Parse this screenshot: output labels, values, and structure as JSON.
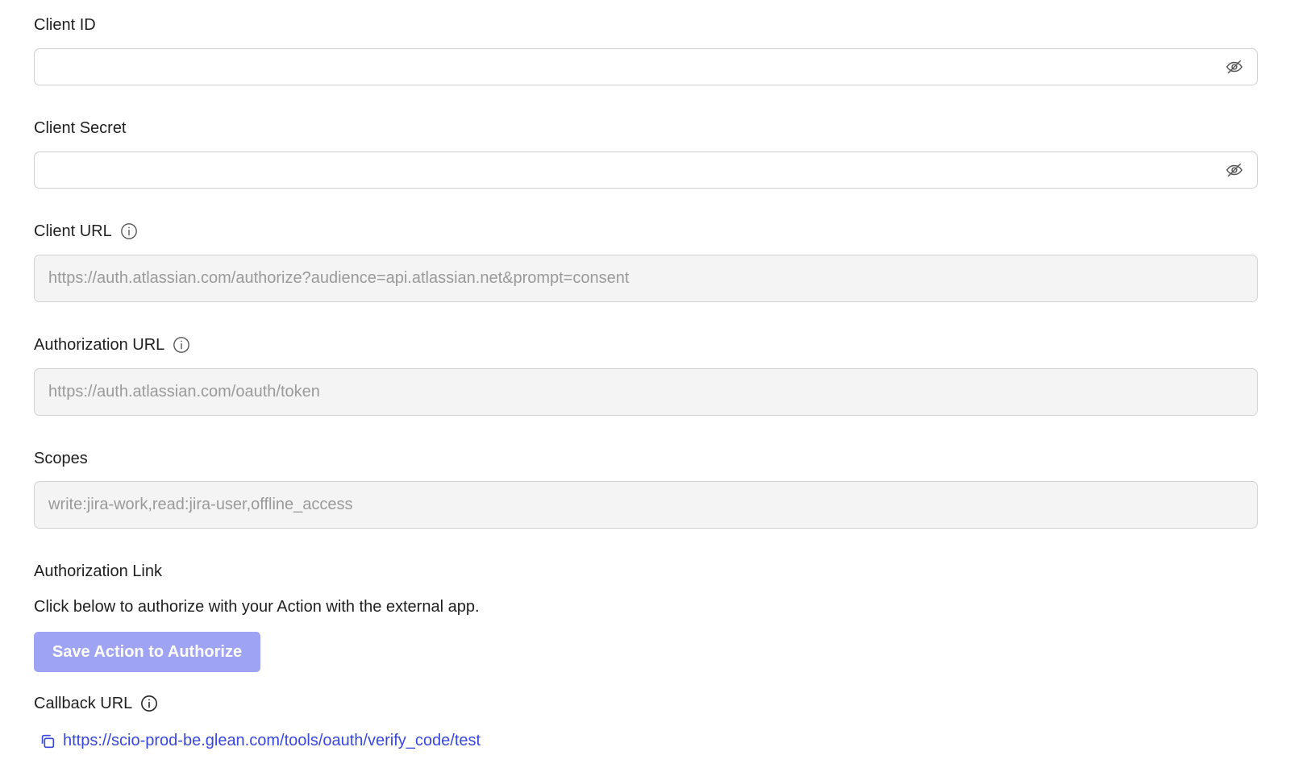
{
  "client_id": {
    "label": "Client ID",
    "value": "",
    "toggle_icon": "eye-slash-icon"
  },
  "client_secret": {
    "label": "Client Secret",
    "value": "",
    "toggle_icon": "eye-slash-icon"
  },
  "client_url": {
    "label": "Client URL",
    "placeholder": "https://auth.atlassian.com/authorize?audience=api.atlassian.net&prompt=consent",
    "info_icon": "info-icon"
  },
  "authorization_url": {
    "label": "Authorization URL",
    "placeholder": "https://auth.atlassian.com/oauth/token",
    "info_icon": "info-icon"
  },
  "scopes": {
    "label": "Scopes",
    "placeholder": "write:jira-work,read:jira-user,offline_access"
  },
  "authorization_link": {
    "heading": "Authorization Link",
    "description": "Click below to authorize with your Action with the external app.",
    "button_label": "Save Action to Authorize"
  },
  "callback_url": {
    "label": "Callback URL",
    "info_icon": "info-icon",
    "copy_icon": "copy-icon",
    "url": "https://scio-prod-be.glean.com/tools/oauth/verify_code/test"
  },
  "colors": {
    "button_bg": "#9fa3f3",
    "link": "#3847e0",
    "readonly_bg": "#f4f4f4",
    "placeholder": "#9a9a9a"
  }
}
